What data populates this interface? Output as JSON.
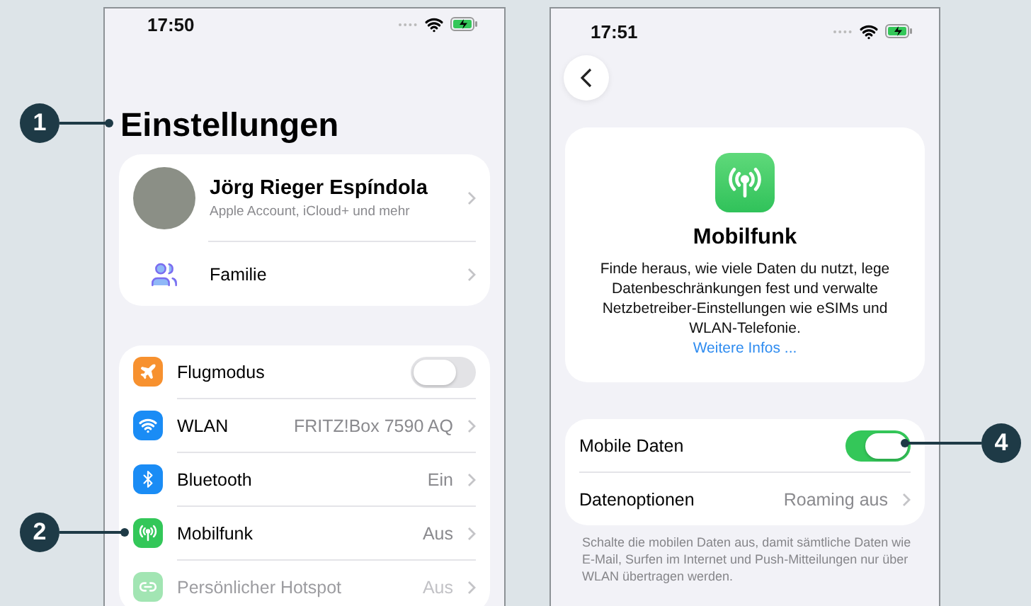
{
  "callouts": [
    {
      "number": "1"
    },
    {
      "number": "2"
    },
    {
      "number": "4"
    }
  ],
  "settings_screen": {
    "time": "17:50",
    "title": "Einstellungen",
    "account": {
      "name": "Jörg Rieger Espíndola",
      "subtitle": "Apple Account, iCloud+ und mehr"
    },
    "family": {
      "label": "Familie"
    },
    "rows": [
      {
        "kind": "toggle",
        "label": "Flugmodus",
        "on": false,
        "disabled": false
      },
      {
        "kind": "value",
        "label": "WLAN",
        "value": "FRITZ!Box 7590 AQ",
        "disabled": false
      },
      {
        "kind": "value",
        "label": "Bluetooth",
        "value": "Ein",
        "disabled": false
      },
      {
        "kind": "value",
        "label": "Mobilfunk",
        "value": "Aus",
        "disabled": false
      },
      {
        "kind": "value",
        "label": "Persönlicher Hotspot",
        "value": "Aus",
        "disabled": true
      }
    ]
  },
  "cellular_screen": {
    "time": "17:51",
    "info": {
      "title": "Mobilfunk",
      "description": "Finde heraus, wie viele Daten du nutzt, lege Datenbeschränkungen fest und verwalte Netzbetreiber-Einstellungen wie eSIMs und WLAN-Telefonie.",
      "link": "Weitere Infos ..."
    },
    "rows": [
      {
        "kind": "toggle",
        "label": "Mobile Daten",
        "on": true
      },
      {
        "kind": "value",
        "label": "Datenoptionen",
        "value": "Roaming aus"
      }
    ],
    "footer": "Schalte die mobilen Daten aus, damit sämtliche Daten wie E-Mail, Surfen im Internet und Push-Mitteilungen nur über WLAN übertragen werden."
  }
}
